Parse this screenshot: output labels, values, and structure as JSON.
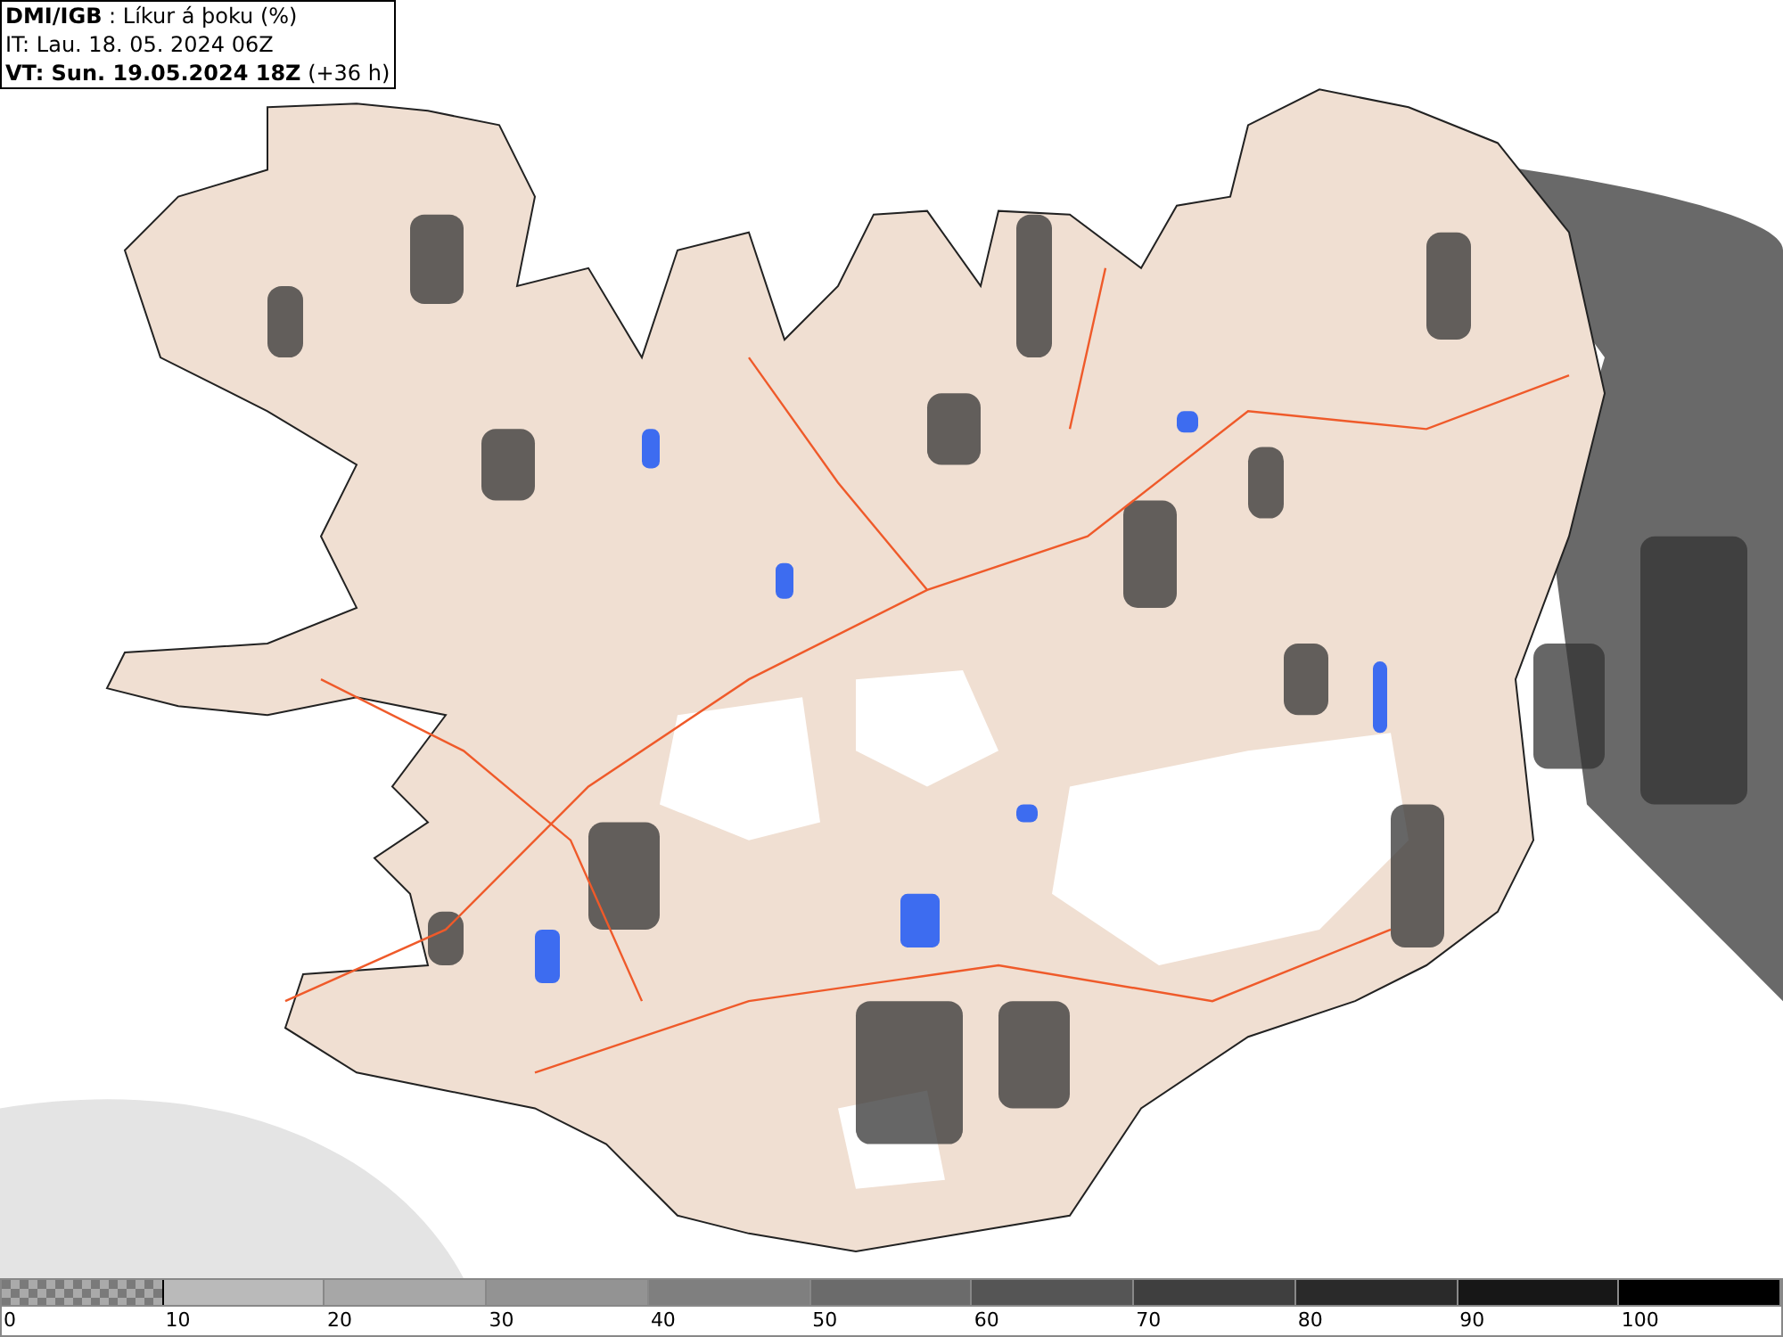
{
  "header": {
    "lines": [
      "**DMI/IGB** : Líkur á þoku (%)",
      "IT: Lau. 18. 05. 2024 06Z",
      "**VT: Sun. 19.05.2024 18Z** (+36 h)"
    ]
  },
  "legend": {
    "swatches": [
      {
        "kind": "checkered",
        "color": "#7a7a7a"
      },
      {
        "kind": "solid",
        "color": "#bababa"
      },
      {
        "kind": "solid",
        "color": "#a7a7a7"
      },
      {
        "kind": "solid",
        "color": "#939393"
      },
      {
        "kind": "solid",
        "color": "#7f7f7f"
      },
      {
        "kind": "solid",
        "color": "#6b6b6b"
      },
      {
        "kind": "solid",
        "color": "#555555"
      },
      {
        "kind": "solid",
        "color": "#3f3f3f"
      },
      {
        "kind": "solid",
        "color": "#2a2a2a"
      },
      {
        "kind": "solid",
        "color": "#171717"
      },
      {
        "kind": "solid",
        "color": "#000000"
      }
    ],
    "ticks": [
      "0",
      "10",
      "20",
      "30",
      "40",
      "50",
      "60",
      "70",
      "80",
      "90",
      "100"
    ]
  }
}
